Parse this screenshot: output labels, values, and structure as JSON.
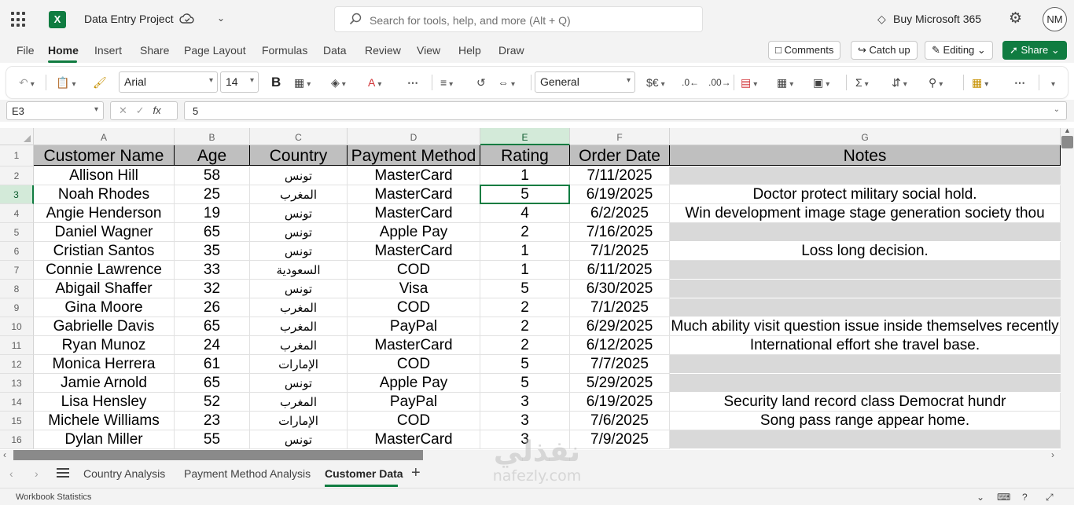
{
  "app": {
    "doc_title": "Data Entry Project",
    "search_placeholder": "Search for tools, help, and more (Alt + Q)",
    "buy_label": "Buy Microsoft 365",
    "avatar_initials": "NM",
    "accent_color": "#107c41"
  },
  "menu": {
    "items": [
      "File",
      "Home",
      "Insert",
      "Share",
      "Page Layout",
      "Formulas",
      "Data",
      "Review",
      "View",
      "Help",
      "Draw"
    ],
    "active": "Home",
    "comments_label": "Comments",
    "catchup_label": "Catch up",
    "editing_label": "Editing",
    "share_label": "Share"
  },
  "ribbon": {
    "font_name": "Arial",
    "font_size": "14",
    "bold_label": "B",
    "number_format": "General",
    "currency_label": "$€"
  },
  "formula_bar": {
    "name_box": "E3",
    "fx_label": "fx",
    "formula": "5"
  },
  "sheet": {
    "column_letters": [
      "A",
      "B",
      "C",
      "D",
      "E",
      "F",
      "G"
    ],
    "row_numbers": [
      "1",
      "2",
      "3",
      "4",
      "5",
      "6",
      "7",
      "8",
      "9",
      "10",
      "11",
      "12",
      "13",
      "14",
      "15",
      "16"
    ],
    "selected_cell": "E3",
    "headers": [
      "Customer Name",
      "Age",
      "Country",
      "Payment Method",
      "Rating",
      "Order Date",
      "Notes"
    ],
    "rows": [
      [
        "Allison Hill",
        "58",
        "تونس",
        "MasterCard",
        "1",
        "7/11/2025",
        ""
      ],
      [
        "Noah Rhodes",
        "25",
        "المغرب",
        "MasterCard",
        "5",
        "6/19/2025",
        "Doctor protect military social hold."
      ],
      [
        "Angie Henderson",
        "19",
        "تونس",
        "MasterCard",
        "4",
        "6/2/2025",
        "Win development image stage generation society thou"
      ],
      [
        "Daniel Wagner",
        "65",
        "تونس",
        "Apple Pay",
        "2",
        "7/16/2025",
        ""
      ],
      [
        "Cristian Santos",
        "35",
        "تونس",
        "MasterCard",
        "1",
        "7/1/2025",
        "Loss long decision."
      ],
      [
        "Connie Lawrence",
        "33",
        "السعودية",
        "COD",
        "1",
        "6/11/2025",
        ""
      ],
      [
        "Abigail Shaffer",
        "32",
        "تونس",
        "Visa",
        "5",
        "6/30/2025",
        ""
      ],
      [
        "Gina Moore",
        "26",
        "المغرب",
        "COD",
        "2",
        "7/1/2025",
        ""
      ],
      [
        "Gabrielle Davis",
        "65",
        "المغرب",
        "PayPal",
        "2",
        "6/29/2025",
        "Much ability visit question issue inside themselves recently"
      ],
      [
        "Ryan Munoz",
        "24",
        "المغرب",
        "MasterCard",
        "2",
        "6/12/2025",
        "International effort she travel base."
      ],
      [
        "Monica Herrera",
        "61",
        "الإمارات",
        "COD",
        "5",
        "7/7/2025",
        ""
      ],
      [
        "Jamie Arnold",
        "65",
        "تونس",
        "Apple Pay",
        "5",
        "5/29/2025",
        ""
      ],
      [
        "Lisa Hensley",
        "52",
        "المغرب",
        "PayPal",
        "3",
        "6/19/2025",
        "Security land record class Democrat hundr"
      ],
      [
        "Michele Williams",
        "23",
        "الإمارات",
        "COD",
        "3",
        "7/6/2025",
        "Song pass range appear home."
      ],
      [
        "Dylan Miller",
        "55",
        "تونس",
        "MasterCard",
        "3",
        "7/9/2025",
        ""
      ]
    ]
  },
  "tabs": {
    "items": [
      "Country Analysis",
      "Payment Method Analysis",
      "Customer Data"
    ],
    "active": "Customer Data"
  },
  "status": {
    "text": "Workbook Statistics"
  },
  "watermark": {
    "arabic": "نفذلي",
    "latin": "nafezly.com"
  }
}
